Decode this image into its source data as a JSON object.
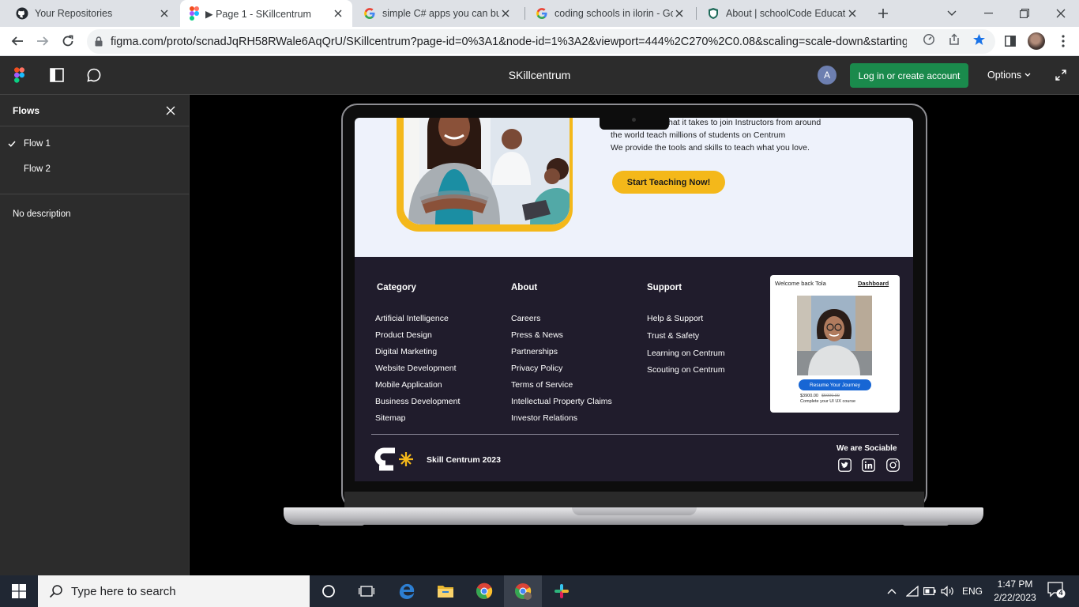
{
  "browser": {
    "tabs": [
      {
        "title": "Your Repositories",
        "icon": "github-icon"
      },
      {
        "title": "▶ Page 1 - SKillcentrum",
        "icon": "figma-icon",
        "active": true
      },
      {
        "title": "simple C# apps you can build",
        "icon": "google-icon"
      },
      {
        "title": "coding schools in ilorin - Goo",
        "icon": "google-icon"
      },
      {
        "title": "About | schoolCode Educatio",
        "icon": "shield-icon"
      }
    ],
    "url": "figma.com/proto/scnadJqRH58RWale6AqQrU/SKillcentrum?page-id=0%3A1&node-id=1%3A2&viewport=444%2C270%2C0.08&scaling=scale-down&starting-poi…"
  },
  "figma": {
    "title": "SKillcentrum",
    "avatar_letter": "A",
    "login_label": "Log in or create account",
    "options_label": "Options"
  },
  "sidebar": {
    "title": "Flows",
    "flows": [
      {
        "label": "Flow 1",
        "selected": true
      },
      {
        "label": "Flow 2",
        "selected": false
      }
    ],
    "description": "No description"
  },
  "prototype": {
    "hero": {
      "line1": "hat it takes to join Instructors from around",
      "line2": "the world teach millions of students on  Centrum",
      "line3": "We provide the tools and skills to teach what you love.",
      "cta": "Start Teaching Now!"
    },
    "footer": {
      "columns": [
        {
          "title": "Category",
          "links": [
            "Artificial Intelligence",
            "Product Design",
            "Digital Marketing",
            "Website Development",
            "Mobile Application",
            "Business Development",
            "Sitemap"
          ]
        },
        {
          "title": "About",
          "links": [
            "Careers",
            "Press & News",
            "Partnerships",
            "Privacy Policy",
            "Terms of Service",
            "Intellectual Property Claims",
            "Investor Relations"
          ]
        },
        {
          "title": "Support",
          "links": [
            "Help & Support",
            "Trust & Safety",
            "Learning on Centrum",
            "Scouting  on Centrum"
          ]
        }
      ],
      "card": {
        "welcome": "Welcome back Tola",
        "dashboard": "Dashboard",
        "button": "Resume Your Journey",
        "price": "$3900.00",
        "old_price": "$5000.00",
        "course": "Complete your UI UX course"
      },
      "brand": "Skill  Centrum 2023",
      "social_title": "We  are Sociable",
      "social_icons": [
        "twitter-icon",
        "linkedin-icon",
        "instagram-icon"
      ]
    },
    "colors": {
      "accent": "#f4b81a",
      "footer_bg": "#201c2c",
      "hero_bg": "#eef2fb",
      "card_button": "#1766d4"
    }
  },
  "taskbar": {
    "search_placeholder": "Type here to search",
    "language": "ENG",
    "time": "1:47 PM",
    "date": "2/22/2023",
    "notifications": "4"
  }
}
